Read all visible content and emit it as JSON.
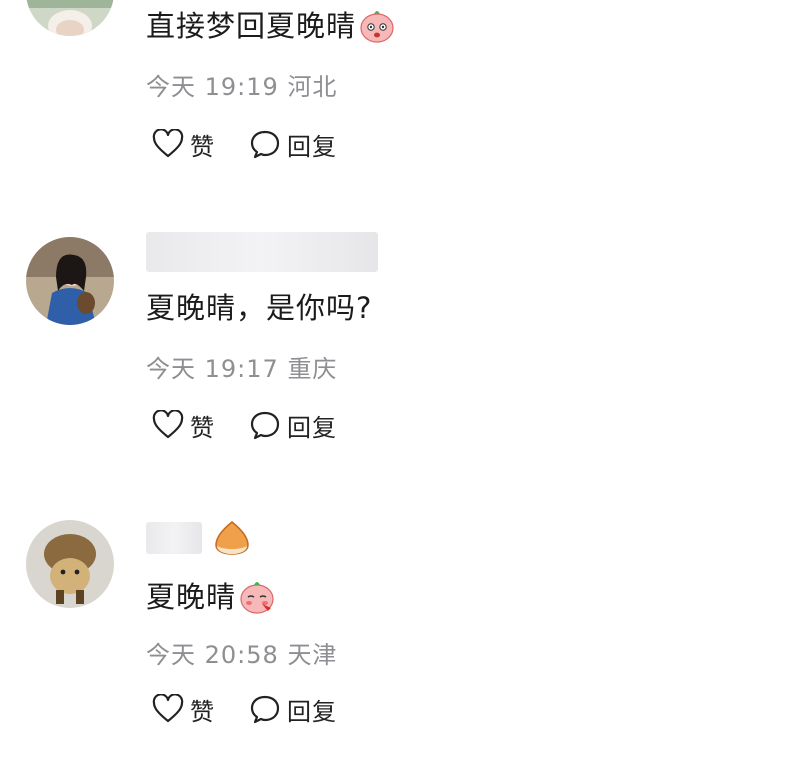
{
  "comments": [
    {
      "text": "直接梦回夏晚晴",
      "emoji": "surprised-face-emoji",
      "time": "今天 19:19",
      "location": "河北"
    },
    {
      "text": "夏晚晴，是你吗?",
      "time": "今天 19:17",
      "location": "重庆"
    },
    {
      "text": "夏晚晴",
      "emoji": "shy-face-emoji",
      "badge_icon": "chestnut-icon",
      "time": "今天 20:58",
      "location": "天津"
    }
  ],
  "actions": {
    "like_label": "赞",
    "reply_label": "回复"
  },
  "colors": {
    "text": "#1b1b1b",
    "meta": "#8e8e93",
    "background": "#ffffff"
  }
}
